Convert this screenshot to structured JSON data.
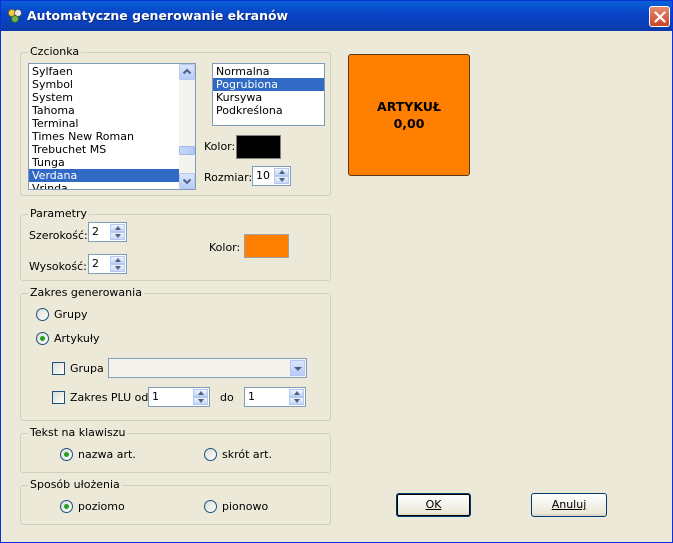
{
  "window": {
    "title": "Automatyczne generowanie ekranów"
  },
  "font_group": {
    "legend": "Czcionka",
    "fonts": [
      "Sylfaen",
      "Symbol",
      "System",
      "Tahoma",
      "Terminal",
      "Times New Roman",
      "Trebuchet MS",
      "Tunga",
      "Verdana",
      "Vrinda"
    ],
    "selected_font": "Verdana",
    "styles": [
      "Normalna",
      "Pogrubiona",
      "Kursywa",
      "Podkreślona"
    ],
    "selected_style": "Pogrubiona",
    "color_label": "Kolor:",
    "text_color": "#000000",
    "size_label": "Rozmiar:",
    "size_value": "10"
  },
  "params_group": {
    "legend": "Parametry",
    "width_label": "Szerokość:",
    "width_value": "2",
    "height_label": "Wysokość:",
    "height_value": "2",
    "color_label": "Kolor:",
    "bg_color": "#ff8000"
  },
  "range_group": {
    "legend": "Zakres generowania",
    "opt_groups": "Grupy",
    "opt_articles": "Artykuły",
    "selected": "Artykuły",
    "group_check_label": "Grupa",
    "group_checked": false,
    "group_value": "",
    "plu_check_label": "Zakres PLU od",
    "plu_checked": false,
    "plu_from": "1",
    "to_label": "do",
    "plu_to": "1"
  },
  "key_text_group": {
    "legend": "Tekst na klawiszu",
    "opt_name": "nazwa art.",
    "opt_short": "skrót art.",
    "selected": "nazwa art."
  },
  "layout_group": {
    "legend": "Sposób ułożenia",
    "opt_horizontal": "poziomo",
    "opt_vertical": "pionowo",
    "selected": "poziomo"
  },
  "preview": {
    "line1": "ARTYKUŁ",
    "line2": "0,00",
    "bg_color": "#ff8000",
    "text_color": "#000000"
  },
  "buttons": {
    "ok": "OK",
    "cancel": "Anuluj"
  }
}
